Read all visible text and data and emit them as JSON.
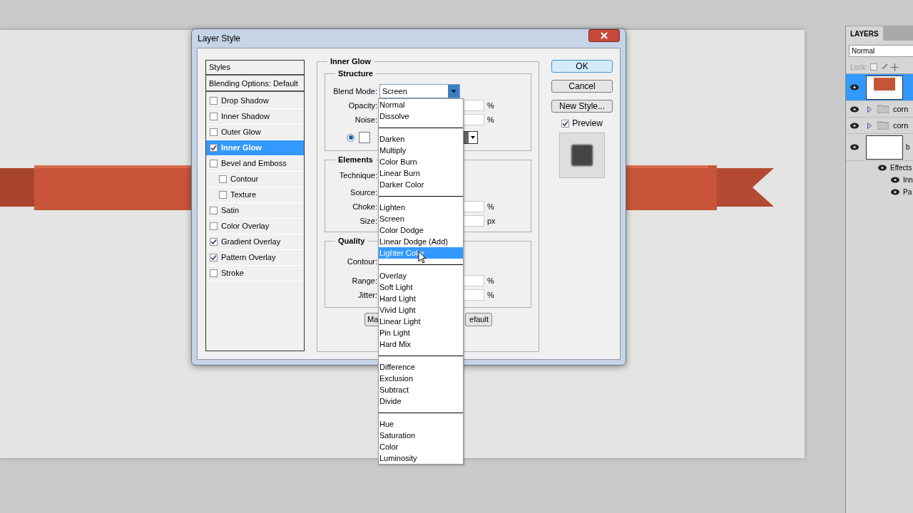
{
  "dialog": {
    "title": "Layer Style",
    "styles_list": [
      {
        "kind": "header",
        "label": "Styles"
      },
      {
        "kind": "header",
        "label": "Blending Options: Default"
      },
      {
        "kind": "check",
        "label": "Drop Shadow",
        "checked": false,
        "selected": false
      },
      {
        "kind": "check",
        "label": "Inner Shadow",
        "checked": false,
        "selected": false
      },
      {
        "kind": "check",
        "label": "Outer Glow",
        "checked": false,
        "selected": false
      },
      {
        "kind": "check",
        "label": "Inner Glow",
        "checked": true,
        "selected": true
      },
      {
        "kind": "check",
        "label": "Bevel and Emboss",
        "checked": false,
        "selected": false,
        "children": [
          {
            "kind": "check",
            "label": "Contour",
            "checked": false,
            "selected": false
          },
          {
            "kind": "check",
            "label": "Texture",
            "checked": false,
            "selected": false
          }
        ]
      },
      {
        "kind": "check",
        "label": "Satin",
        "checked": false,
        "selected": false
      },
      {
        "kind": "check",
        "label": "Color Overlay",
        "checked": false,
        "selected": false
      },
      {
        "kind": "check",
        "label": "Gradient Overlay",
        "checked": true,
        "selected": false
      },
      {
        "kind": "check",
        "label": "Pattern Overlay",
        "checked": true,
        "selected": false
      },
      {
        "kind": "check",
        "label": "Stroke",
        "checked": false,
        "selected": false
      }
    ],
    "panel": {
      "title": "Inner Glow",
      "structure": {
        "title": "Structure",
        "blend_mode_label": "Blend Mode:",
        "blend_mode": "Screen",
        "opacity_label": "Opacity:",
        "opacity_unit": "%",
        "noise_label": "Noise:",
        "noise_unit": "%",
        "solid_color_selected": true
      },
      "elements": {
        "title": "Elements",
        "technique_label": "Technique:",
        "source_label": "Source:",
        "choke_label": "Choke:",
        "choke_unit": "%",
        "size_label": "Size:",
        "size_unit": "px"
      },
      "quality": {
        "title": "Quality",
        "contour_label": "Contour:",
        "range_label": "Range:",
        "range_unit": "%",
        "jitter_label": "Jitter:",
        "jitter_unit": "%"
      },
      "buttons": [
        "Ma",
        "efault"
      ]
    },
    "actions": [
      {
        "label": "OK",
        "default": true
      },
      {
        "label": "Cancel",
        "default": false
      },
      {
        "label": "New Style...",
        "default": false
      }
    ],
    "preview": {
      "label": "Preview",
      "checked": true
    }
  },
  "blend_menu": {
    "groups": [
      [
        {
          "label": "Normal",
          "selected": false
        },
        {
          "label": "Dissolve",
          "selected": false
        }
      ],
      [
        {
          "label": "Darken",
          "selected": false
        },
        {
          "label": "Multiply",
          "selected": false
        },
        {
          "label": "Color Burn",
          "selected": false
        },
        {
          "label": "Linear Burn",
          "selected": false
        },
        {
          "label": "Darker Color",
          "selected": false
        }
      ],
      [
        {
          "label": "Lighten",
          "selected": false
        },
        {
          "label": "Screen",
          "selected": false
        },
        {
          "label": "Color Dodge",
          "selected": false
        },
        {
          "label": "Linear Dodge (Add)",
          "selected": false
        },
        {
          "label": "Lighter Color",
          "selected": true
        }
      ],
      [
        {
          "label": "Overlay",
          "selected": false
        },
        {
          "label": "Soft Light",
          "selected": false
        },
        {
          "label": "Hard Light",
          "selected": false
        },
        {
          "label": "Vivid Light",
          "selected": false
        },
        {
          "label": "Linear Light",
          "selected": false
        },
        {
          "label": "Pin Light",
          "selected": false
        },
        {
          "label": "Hard Mix",
          "selected": false
        }
      ],
      [
        {
          "label": "Difference",
          "selected": false
        },
        {
          "label": "Exclusion",
          "selected": false
        },
        {
          "label": "Subtract",
          "selected": false
        },
        {
          "label": "Divide",
          "selected": false
        }
      ],
      [
        {
          "label": "Hue",
          "selected": false
        },
        {
          "label": "Saturation",
          "selected": false
        },
        {
          "label": "Color",
          "selected": false
        },
        {
          "label": "Luminosity",
          "selected": false
        }
      ]
    ]
  },
  "layers_panel": {
    "tab": "LAYERS",
    "blend_mode": "Normal",
    "lock_label": "Lock:",
    "layers": [
      {
        "kind": "shape_layer",
        "selected": true
      },
      {
        "kind": "group",
        "name": "corn",
        "selected": false
      },
      {
        "kind": "group",
        "name": "corn",
        "selected": false
      },
      {
        "kind": "layer",
        "name": "b",
        "selected": false,
        "children": [
          {
            "kind": "effects",
            "name": "Effects",
            "children": [
              {
                "name": "Inn"
              },
              {
                "name": "Pa"
              }
            ]
          }
        ]
      }
    ]
  }
}
